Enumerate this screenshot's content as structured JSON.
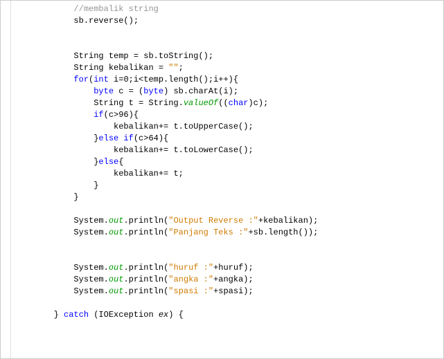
{
  "code": {
    "indent_base": "            ",
    "lines": [
      {
        "indent": 0,
        "spans": [
          {
            "cls": "comment",
            "t": "//membalik string"
          }
        ]
      },
      {
        "indent": 0,
        "spans": [
          {
            "cls": "plain",
            "t": "sb.reverse();"
          }
        ]
      },
      {
        "blank": true
      },
      {
        "blank": true
      },
      {
        "indent": 0,
        "spans": [
          {
            "cls": "plain",
            "t": "String temp = sb.toString();"
          }
        ]
      },
      {
        "indent": 0,
        "spans": [
          {
            "cls": "plain",
            "t": "String kebalikan = "
          },
          {
            "cls": "string",
            "t": "\"\""
          },
          {
            "cls": "plain",
            "t": ";"
          }
        ]
      },
      {
        "indent": 0,
        "spans": [
          {
            "cls": "keyword",
            "t": "for"
          },
          {
            "cls": "plain",
            "t": "("
          },
          {
            "cls": "keyword",
            "t": "int"
          },
          {
            "cls": "plain",
            "t": " i=0;i<temp.length();i++){"
          }
        ]
      },
      {
        "indent": 1,
        "spans": [
          {
            "cls": "keyword",
            "t": "byte"
          },
          {
            "cls": "plain",
            "t": " c = ("
          },
          {
            "cls": "keyword",
            "t": "byte"
          },
          {
            "cls": "plain",
            "t": ") sb.charAt(i);"
          }
        ]
      },
      {
        "indent": 1,
        "spans": [
          {
            "cls": "plain",
            "t": "String t = String."
          },
          {
            "cls": "static",
            "t": "valueOf"
          },
          {
            "cls": "plain",
            "t": "(("
          },
          {
            "cls": "keyword",
            "t": "char"
          },
          {
            "cls": "plain",
            "t": ")c);"
          }
        ]
      },
      {
        "indent": 1,
        "spans": [
          {
            "cls": "keyword",
            "t": "if"
          },
          {
            "cls": "plain",
            "t": "(c>96){"
          }
        ]
      },
      {
        "indent": 2,
        "spans": [
          {
            "cls": "plain",
            "t": "kebalikan+= t.toUpperCase();"
          }
        ]
      },
      {
        "indent": 1,
        "spans": [
          {
            "cls": "plain",
            "t": "}"
          },
          {
            "cls": "keyword",
            "t": "else if"
          },
          {
            "cls": "plain",
            "t": "(c>64){"
          }
        ]
      },
      {
        "indent": 2,
        "spans": [
          {
            "cls": "plain",
            "t": "kebalikan+= t.toLowerCase();"
          }
        ]
      },
      {
        "indent": 1,
        "spans": [
          {
            "cls": "plain",
            "t": "}"
          },
          {
            "cls": "keyword",
            "t": "else"
          },
          {
            "cls": "plain",
            "t": "{"
          }
        ]
      },
      {
        "indent": 2,
        "spans": [
          {
            "cls": "plain",
            "t": "kebalikan+= t;"
          }
        ]
      },
      {
        "indent": 1,
        "spans": [
          {
            "cls": "plain",
            "t": "}"
          }
        ]
      },
      {
        "indent": 0,
        "spans": [
          {
            "cls": "plain",
            "t": "}"
          }
        ]
      },
      {
        "blank": true
      },
      {
        "indent": 0,
        "spans": [
          {
            "cls": "plain",
            "t": "System."
          },
          {
            "cls": "static",
            "t": "out"
          },
          {
            "cls": "plain",
            "t": ".println("
          },
          {
            "cls": "string",
            "t": "\"Output Reverse :\""
          },
          {
            "cls": "plain",
            "t": "+kebalikan);"
          }
        ]
      },
      {
        "indent": 0,
        "spans": [
          {
            "cls": "plain",
            "t": "System."
          },
          {
            "cls": "static",
            "t": "out"
          },
          {
            "cls": "plain",
            "t": ".println("
          },
          {
            "cls": "string",
            "t": "\"Panjang Teks :\""
          },
          {
            "cls": "plain",
            "t": "+sb.length());"
          }
        ]
      },
      {
        "blank": true
      },
      {
        "blank": true
      },
      {
        "indent": 0,
        "spans": [
          {
            "cls": "plain",
            "t": "System."
          },
          {
            "cls": "static",
            "t": "out"
          },
          {
            "cls": "plain",
            "t": ".println("
          },
          {
            "cls": "string",
            "t": "\"huruf :\""
          },
          {
            "cls": "plain",
            "t": "+huruf);"
          }
        ]
      },
      {
        "indent": 0,
        "spans": [
          {
            "cls": "plain",
            "t": "System."
          },
          {
            "cls": "static",
            "t": "out"
          },
          {
            "cls": "plain",
            "t": ".println("
          },
          {
            "cls": "string",
            "t": "\"angka :\""
          },
          {
            "cls": "plain",
            "t": "+angka);"
          }
        ]
      },
      {
        "indent": 0,
        "spans": [
          {
            "cls": "plain",
            "t": "System."
          },
          {
            "cls": "static",
            "t": "out"
          },
          {
            "cls": "plain",
            "t": ".println("
          },
          {
            "cls": "string",
            "t": "\"spasi :\""
          },
          {
            "cls": "plain",
            "t": "+spasi);"
          }
        ]
      },
      {
        "blank": true
      },
      {
        "indent": -1,
        "spans": [
          {
            "cls": "plain",
            "t": "} "
          },
          {
            "cls": "keyword",
            "t": "catch"
          },
          {
            "cls": "plain",
            "t": " (IOException "
          },
          {
            "cls": "method",
            "t": "ex"
          },
          {
            "cls": "plain",
            "t": ") {"
          }
        ]
      }
    ],
    "step_indent": "    ",
    "outdent_indent": "        "
  }
}
